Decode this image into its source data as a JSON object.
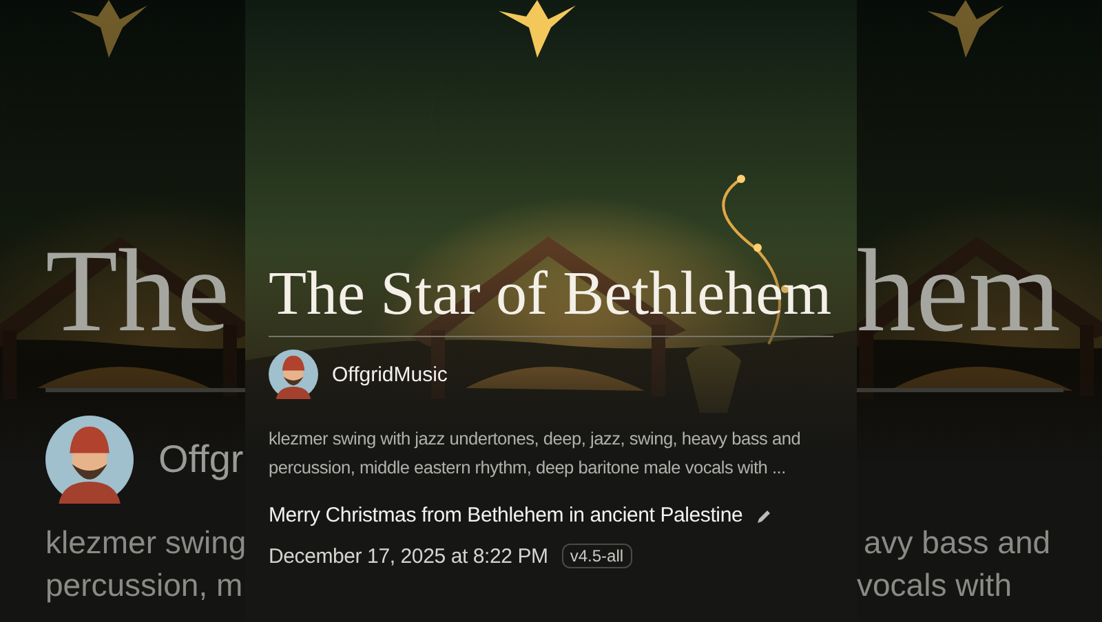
{
  "backdrop": {
    "left": {
      "title": "The",
      "author": "Offgr",
      "lines": [
        "klezmer swing",
        "percussion, m"
      ]
    },
    "right": {
      "title": "hem",
      "lines": [
        "avy bass and",
        "vocals with"
      ]
    }
  },
  "song": {
    "title": "The Star of Bethlehem",
    "author": "OffgridMusic",
    "description": "klezmer swing with jazz undertones, deep, jazz, swing, heavy bass and percussion, middle eastern rhythm, deep baritone male vocals with ...",
    "caption": "Merry Christmas from Bethlehem in ancient Palestine",
    "date": "December 17, 2025 at 8:22 PM",
    "version": "v4.5-all"
  }
}
